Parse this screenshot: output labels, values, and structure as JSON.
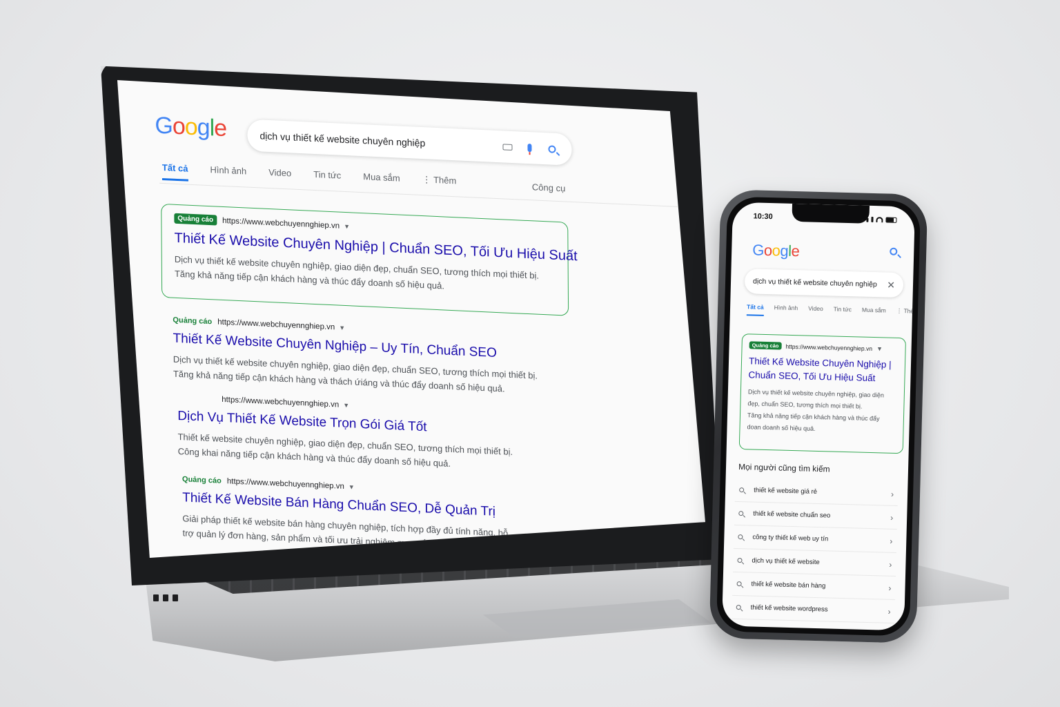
{
  "colors": {
    "link": "#1a0dab",
    "accent": "#1a73e8",
    "ad_green": "#188038",
    "ad_border": "#34a853"
  },
  "desktop": {
    "logo": [
      "G",
      "o",
      "o",
      "g",
      "l",
      "e"
    ],
    "search_query": "dịch vụ thiết kế website chuyên nghiệp",
    "icons": {
      "keyboard": "keyboard-icon",
      "mic": "mic-icon",
      "search": "search-icon"
    },
    "tabs": [
      {
        "label": "Tất cả"
      },
      {
        "label": "Hình ảnh"
      },
      {
        "label": "Video"
      },
      {
        "label": "Tin tức"
      },
      {
        "label": "Mua sắm"
      },
      {
        "label": "⋮ Thêm"
      }
    ],
    "tools_label": "Công cụ",
    "results": [
      {
        "badge": "Quảng cáo",
        "url": "https://www.webchuyennghiep.vn",
        "title": "Thiết Kế Website Chuyên Nghiệp | Chuẩn SEO, Tối Ưu Hiệu Suất",
        "desc1": "Dịch vụ thiết kế website chuyên nghiệp, giao diện đẹp, chuẩn SEO, tương thích mọi thiết bị.",
        "desc2": "Tăng khả năng tiếp cận khách hàng và thúc đẩy doanh số hiệu quả."
      },
      {
        "badge": "Quảng cáo",
        "url": "https://www.webchuyennghiep.vn",
        "title": "Thiết Kế Website Chuyên Nghiệp – Uy Tín, Chuẩn SEO",
        "desc1": "Dịch vụ thiết kế website chuyên nghiệp, giao diện đẹp, chuẩn SEO, tương thích mọi thiết bị.",
        "desc2": "Tăng khả năng tiếp cận khách hàng và thách ứiáng và thúc đẩy doanh số hiệu quả."
      },
      {
        "badge": "",
        "url": "https://www.webchuyennghiep.vn",
        "title": "Dịch Vụ Thiết Kế Website Trọn Gói Giá Tốt",
        "desc1": "Thiết kế website chuyên nghiệp, giao diện đẹp, chuẩn SEO, tương thích mọi thiết bị.",
        "desc2": "Công khai năng tiếp cận khách hàng và thúc đẩy doanh số hiệu quả."
      },
      {
        "badge": "Quảng cáo",
        "url": "https://www.webchuyennghiep.vn",
        "title": "Thiết Kế Website Bán Hàng Chuẩn SEO, Dễ Quản Trị",
        "desc1": "Giải pháp thiết kế website bán hàng chuyên nghiệp, tích hợp đầy đủ tính năng, hỗ",
        "desc2": "trợ quản lý đơn hàng, sản phẩm và tối ưu trải nghiệm mua sắm."
      }
    ]
  },
  "mobile": {
    "time": "10:30",
    "logo": [
      "G",
      "o",
      "o",
      "g",
      "l",
      "e"
    ],
    "search_query": "dịch vụ thiết kế website chuyên nghiệp",
    "tabs": [
      {
        "label": "Tất cả"
      },
      {
        "label": "Hình ảnh"
      },
      {
        "label": "Video"
      },
      {
        "label": "Tin tức"
      },
      {
        "label": "Mua sắm"
      },
      {
        "label": "⋮ Thêm"
      }
    ],
    "ad": {
      "badge": "Quảng cáo",
      "url": "https://www.webchuyennghiep.vn",
      "title1": "Thiết Kế Website Chuyên Nghiệp |",
      "title2": "Chuẩn SEO, Tối Ưu Hiệu Suất",
      "desc1": "Dịch vụ thiết kế website chuyên nghiệp, giao diện",
      "desc2": "đẹp, chuẩn SEO, tương thích mọi thiết bị.",
      "desc3": "Tăng khả năng tiếp cận khách hàng và thúc đẩy",
      "desc4": "doan doanh số hiệu quả."
    },
    "people_also_search": "Mọi người cũng tìm kiếm",
    "suggestions": [
      {
        "label": "thiết kế website giá rẻ"
      },
      {
        "label": "thiết kế website chuẩn seo"
      },
      {
        "label": "công ty thiết kế web uy tín"
      },
      {
        "label": "dịch vụ thiết kế website"
      },
      {
        "label": "thiết kế website bán hàng"
      },
      {
        "label": "thiết kế website wordpress"
      }
    ]
  }
}
